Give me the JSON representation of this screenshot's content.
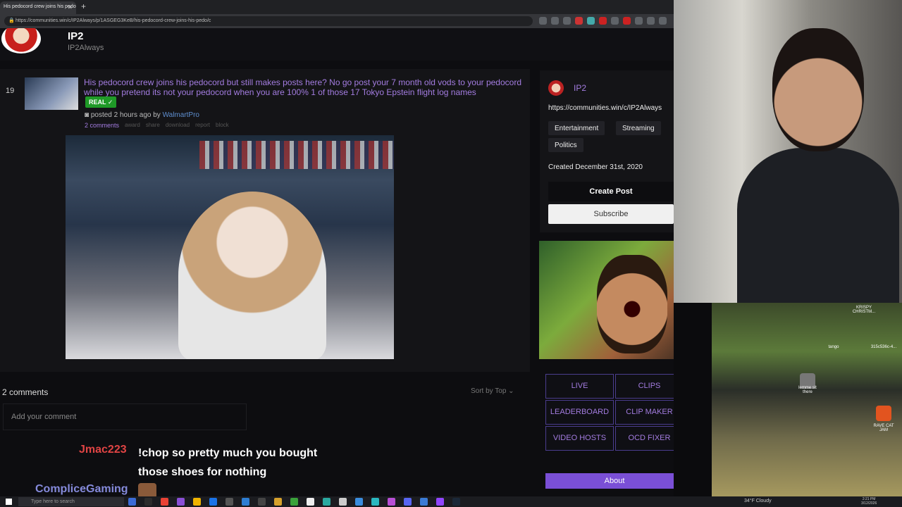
{
  "browser": {
    "tab_title": "His pedocord crew joins his pedo",
    "tab_close": "✕",
    "new_tab": "+",
    "url": "https://communities.win/c/IP2Always/p/1ASGEG3KeB/his-pedocord-crew-joins-his-pedo/c"
  },
  "header": {
    "name": "IP2",
    "handle": "IP2Always"
  },
  "post": {
    "score": "19",
    "title": "His pedocord crew joins his pedocord but still makes posts here? No go post your 7 month old vods to your pedocord while you pretend its not your pedocord when you are 100% 1 of those 17 Tokyo Epstein flight log names",
    "flair": "REAL ✓",
    "posted_prefix": "posted 2 hours ago by",
    "author": "WalmartPro",
    "comments_link": "2 comments",
    "actions": [
      "award",
      "share",
      "download",
      "report",
      "block"
    ]
  },
  "comments": {
    "count_label": "2 comments",
    "sort_label": "Sort by Top ⌄",
    "input_placeholder": "Add your comment"
  },
  "sidebar": {
    "name": "IP2",
    "url": "https://communities.win/c/IP2Always",
    "tags": [
      "Entertainment",
      "Streaming",
      "Politics"
    ],
    "created": "Created December 31st, 2020",
    "create_post": "Create Post",
    "subscribe": "Subscribe",
    "nav": [
      "LIVE",
      "CLIPS",
      "LEADERBOARD",
      "CLIP MAKER",
      "VIDEO HOSTS",
      "OCD FIXER"
    ],
    "about": "About"
  },
  "overlay": {
    "chat_user": "Jmac223",
    "chat_message": "!chop so pretty much you bought those shoes for nothing",
    "chat_user2": "CompliceGaming"
  },
  "desktop": {
    "icons": [
      {
        "label": "KRISPY CHRISTM..."
      },
      {
        "label": "tango"
      },
      {
        "label": "315c536c-4..."
      },
      {
        "label": "lemme sit there"
      },
      {
        "label": "RAVE CAT JAM"
      }
    ]
  },
  "taskbar": {
    "search_placeholder": "Type here to search",
    "weather": "34°F Cloudy",
    "time": "2:21 PM",
    "date": "3/12/2026"
  },
  "colors": {
    "accent": "#a37ce0",
    "flair_green": "#1f9a27",
    "about_purple": "#7a4fd6",
    "chat_red": "#e04444"
  }
}
